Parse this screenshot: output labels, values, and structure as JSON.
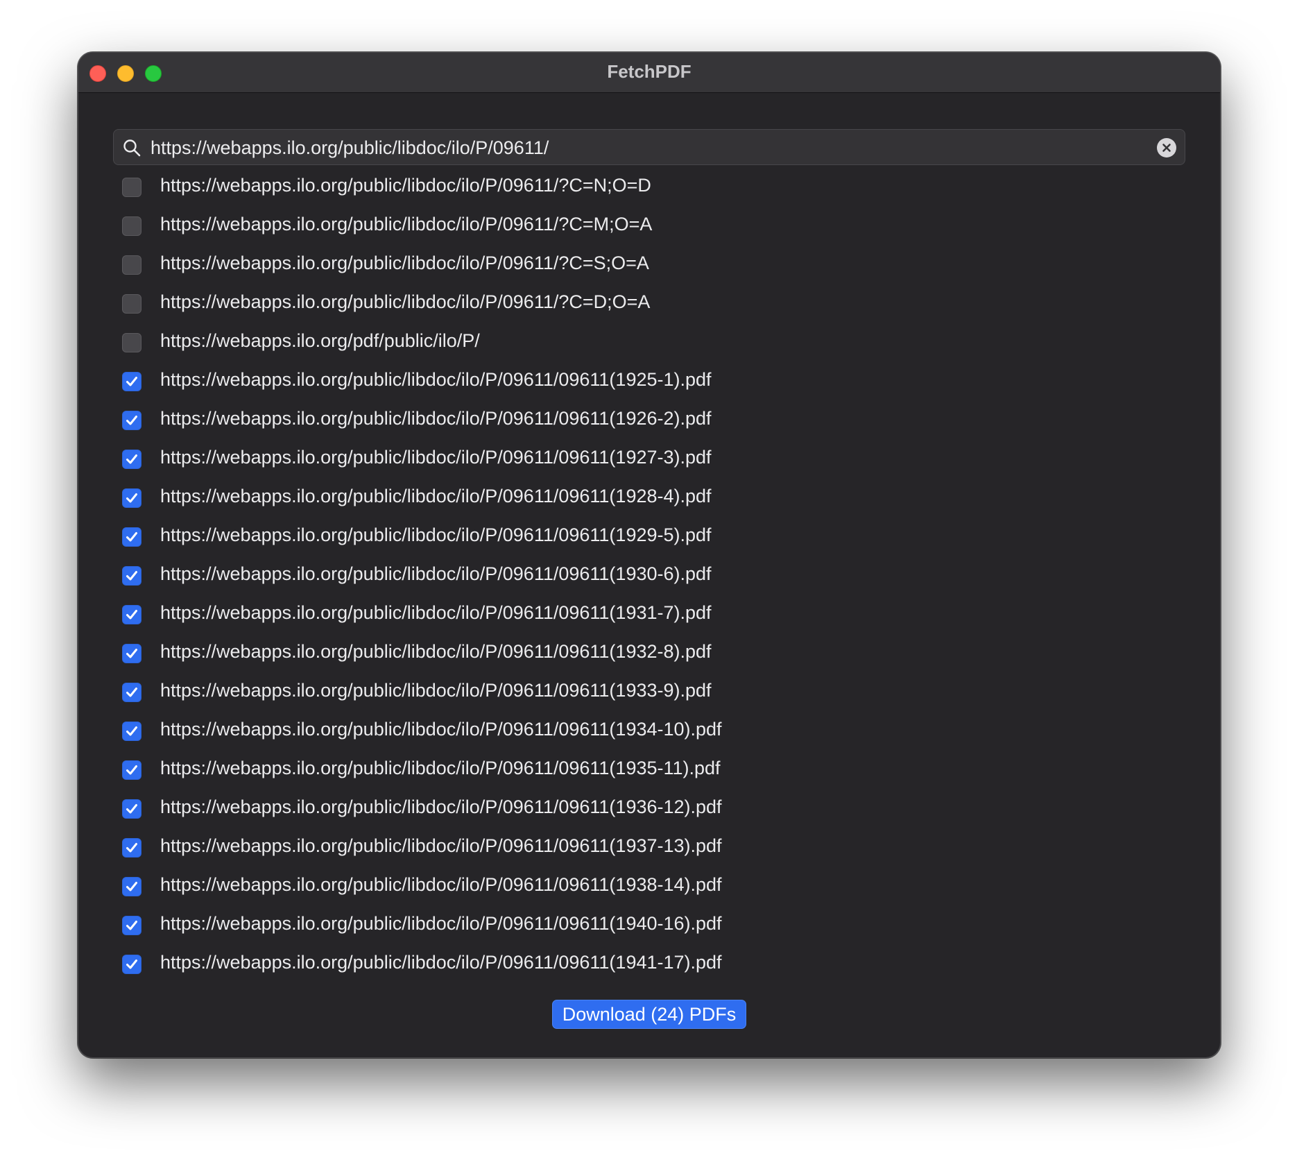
{
  "window": {
    "title": "FetchPDF",
    "traffic_lights": {
      "close": "#fe5f57",
      "minimize": "#febc2e",
      "maximize": "#28c840"
    }
  },
  "search": {
    "value": "https://webapps.ilo.org/public/libdoc/ilo/P/09611/",
    "icon": "search-icon",
    "clear_icon": "clear-icon"
  },
  "links": [
    {
      "url": "https://webapps.ilo.org/public/libdoc/ilo/P/09611/?C=N;O=D",
      "checked": false
    },
    {
      "url": "https://webapps.ilo.org/public/libdoc/ilo/P/09611/?C=M;O=A",
      "checked": false
    },
    {
      "url": "https://webapps.ilo.org/public/libdoc/ilo/P/09611/?C=S;O=A",
      "checked": false
    },
    {
      "url": "https://webapps.ilo.org/public/libdoc/ilo/P/09611/?C=D;O=A",
      "checked": false
    },
    {
      "url": "https://webapps.ilo.org/pdf/public/ilo/P/",
      "checked": false
    },
    {
      "url": "https://webapps.ilo.org/public/libdoc/ilo/P/09611/09611(1925-1).pdf",
      "checked": true
    },
    {
      "url": "https://webapps.ilo.org/public/libdoc/ilo/P/09611/09611(1926-2).pdf",
      "checked": true
    },
    {
      "url": "https://webapps.ilo.org/public/libdoc/ilo/P/09611/09611(1927-3).pdf",
      "checked": true
    },
    {
      "url": "https://webapps.ilo.org/public/libdoc/ilo/P/09611/09611(1928-4).pdf",
      "checked": true
    },
    {
      "url": "https://webapps.ilo.org/public/libdoc/ilo/P/09611/09611(1929-5).pdf",
      "checked": true
    },
    {
      "url": "https://webapps.ilo.org/public/libdoc/ilo/P/09611/09611(1930-6).pdf",
      "checked": true
    },
    {
      "url": "https://webapps.ilo.org/public/libdoc/ilo/P/09611/09611(1931-7).pdf",
      "checked": true
    },
    {
      "url": "https://webapps.ilo.org/public/libdoc/ilo/P/09611/09611(1932-8).pdf",
      "checked": true
    },
    {
      "url": "https://webapps.ilo.org/public/libdoc/ilo/P/09611/09611(1933-9).pdf",
      "checked": true
    },
    {
      "url": "https://webapps.ilo.org/public/libdoc/ilo/P/09611/09611(1934-10).pdf",
      "checked": true
    },
    {
      "url": "https://webapps.ilo.org/public/libdoc/ilo/P/09611/09611(1935-11).pdf",
      "checked": true
    },
    {
      "url": "https://webapps.ilo.org/public/libdoc/ilo/P/09611/09611(1936-12).pdf",
      "checked": true
    },
    {
      "url": "https://webapps.ilo.org/public/libdoc/ilo/P/09611/09611(1937-13).pdf",
      "checked": true
    },
    {
      "url": "https://webapps.ilo.org/public/libdoc/ilo/P/09611/09611(1938-14).pdf",
      "checked": true
    },
    {
      "url": "https://webapps.ilo.org/public/libdoc/ilo/P/09611/09611(1940-16).pdf",
      "checked": true
    },
    {
      "url": "https://webapps.ilo.org/public/libdoc/ilo/P/09611/09611(1941-17).pdf",
      "checked": true
    }
  ],
  "download_button": {
    "label": "Download (24) PDFs"
  },
  "colors": {
    "accent": "#2f6df0",
    "window_bg": "#262528",
    "titlebar_bg": "#363538",
    "text": "#ececee"
  }
}
